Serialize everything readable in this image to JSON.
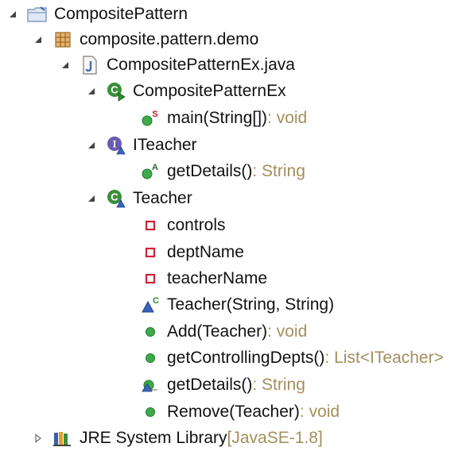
{
  "tree": {
    "project": {
      "label": "CompositePattern",
      "icon": "project-folder-icon"
    },
    "package": {
      "label": "composite.pattern.demo",
      "icon": "package-icon"
    },
    "file": {
      "label": "CompositePatternEx.java",
      "icon": "java-file-icon"
    },
    "class_main": {
      "label": "CompositePatternEx",
      "icon": "class-runnable-icon"
    },
    "method_main": {
      "label": "main(String[])",
      "signature": " : void",
      "icon": "static-method-icon"
    },
    "interface": {
      "label": "ITeacher",
      "icon": "interface-icon"
    },
    "interface_method": {
      "label": "getDetails()",
      "signature": " : String",
      "icon": "abstract-method-icon"
    },
    "class_teacher": {
      "label": "Teacher",
      "icon": "class-icon"
    },
    "field_controls": {
      "label": "controls",
      "icon": "private-field-icon"
    },
    "field_dept": {
      "label": "deptName",
      "icon": "private-field-icon"
    },
    "field_teacher": {
      "label": "teacherName",
      "icon": "private-field-icon"
    },
    "ctor": {
      "label": "Teacher(String, String)",
      "icon": "constructor-icon"
    },
    "m_add": {
      "label": "Add(Teacher)",
      "signature": " : void",
      "icon": "public-method-icon"
    },
    "m_getctrl": {
      "label": "getControllingDepts()",
      "signature": " : List<ITeacher>",
      "icon": "public-method-icon"
    },
    "m_getdetails": {
      "label": "getDetails()",
      "signature": " : String",
      "icon": "override-method-icon"
    },
    "m_remove": {
      "label": "Remove(Teacher)",
      "signature": " : void",
      "icon": "public-method-icon"
    },
    "jre": {
      "label": "JRE System Library",
      "signature": " [JavaSE-1.8]",
      "icon": "library-icon"
    }
  },
  "colors": {
    "signature": "#a38f5c",
    "method_green": "#3faa4a",
    "private_red": "#d0223a",
    "class_green": "#3a8f3a",
    "interface_purple": "#6a5bb0"
  }
}
